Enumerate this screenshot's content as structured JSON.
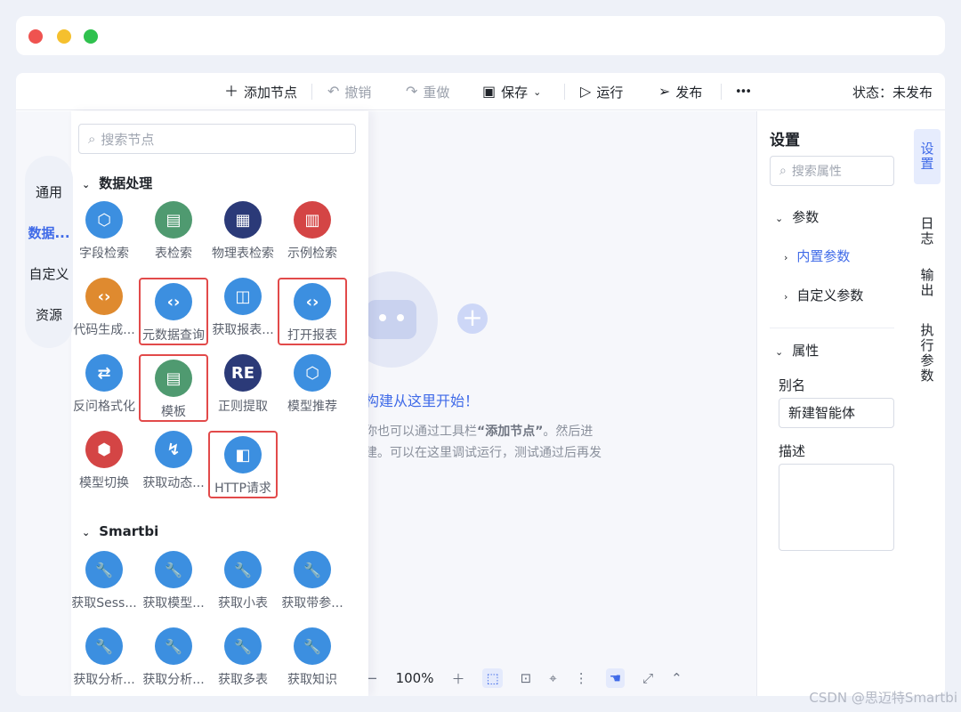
{
  "toolbar": {
    "add_node": "添加节点",
    "undo": "撤销",
    "redo": "重做",
    "save": "保存",
    "run": "运行",
    "publish": "发布",
    "more": "•••",
    "status": "状态：未发布"
  },
  "left_rail": [
    "通用",
    "数据...",
    "自定义",
    "资源"
  ],
  "panel": {
    "search_placeholder": "搜索节点",
    "sections": [
      {
        "title": "数据处理",
        "nodes": [
          {
            "label": "字段检索",
            "color": "#3c8fe0",
            "icon": "cube-search-icon",
            "highlighted": false
          },
          {
            "label": "表检索",
            "color": "#4f9a70",
            "icon": "table-search-icon",
            "highlighted": false
          },
          {
            "label": "物理表检索",
            "color": "#2b3a78",
            "icon": "physical-table-search-icon",
            "highlighted": false
          },
          {
            "label": "示例检索",
            "color": "#d44545",
            "icon": "example-search-icon",
            "highlighted": false
          },
          {
            "label": "代码生成...",
            "color": "#df8a2f",
            "icon": "code-gen-icon",
            "highlighted": false
          },
          {
            "label": "元数据查询",
            "color": "#3c8fe0",
            "icon": "code-window-icon",
            "highlighted": true
          },
          {
            "label": "获取报表...",
            "color": "#3c8fe0",
            "icon": "report-search-icon",
            "highlighted": false
          },
          {
            "label": "打开报表",
            "color": "#3c8fe0",
            "icon": "code-window-icon",
            "highlighted": true
          },
          {
            "label": "反问格式化",
            "color": "#3c8fe0",
            "icon": "format-icon",
            "highlighted": false
          },
          {
            "label": "模板",
            "color": "#4f9a70",
            "icon": "template-icon",
            "highlighted": true
          },
          {
            "label": "正则提取",
            "color": "#2b3a78",
            "icon": "regex-icon",
            "highlighted": false
          },
          {
            "label": "模型推荐",
            "color": "#3c8fe0",
            "icon": "cube-star-icon",
            "highlighted": false
          },
          {
            "label": "模型切换",
            "color": "#d44545",
            "icon": "cube-switch-icon",
            "highlighted": false
          },
          {
            "label": "获取动态...",
            "color": "#3c8fe0",
            "icon": "dynamic-icon",
            "highlighted": false
          },
          {
            "label": "HTTP请求",
            "color": "#3c8fe0",
            "icon": "layout-icon",
            "highlighted": true
          }
        ]
      },
      {
        "title": "Smartbi",
        "nodes": [
          {
            "label": "获取Sess...",
            "color": "#3c8fe0",
            "icon": "wrench-icon",
            "highlighted": false
          },
          {
            "label": "获取模型...",
            "color": "#3c8fe0",
            "icon": "wrench-icon",
            "highlighted": false
          },
          {
            "label": "获取小表",
            "color": "#3c8fe0",
            "icon": "wrench-icon",
            "highlighted": false
          },
          {
            "label": "获取带参...",
            "color": "#3c8fe0",
            "icon": "wrench-icon",
            "highlighted": false
          },
          {
            "label": "获取分析...",
            "color": "#3c8fe0",
            "icon": "wrench-icon",
            "highlighted": false
          },
          {
            "label": "获取分析...",
            "color": "#3c8fe0",
            "icon": "wrench-icon",
            "highlighted": false
          },
          {
            "label": "获取多表",
            "color": "#3c8fe0",
            "icon": "wrench-icon",
            "highlighted": false
          },
          {
            "label": "获取知识",
            "color": "#3c8fe0",
            "icon": "wrench-icon",
            "highlighted": false
          }
        ]
      }
    ]
  },
  "canvas": {
    "title": "构建从这里开始！",
    "desc_line1_prefix": "你也可以通过工具栏",
    "desc_bold": "“添加节点”",
    "desc_line1_suffix": "。然后进",
    "desc_line2": "建。可以在这里调试运行，测试通过后再发",
    "zoom": "100%"
  },
  "settings": {
    "title": "设置",
    "search_placeholder": "搜索属性",
    "params_label": "参数",
    "builtin_params": "内置参数",
    "custom_params": "自定义参数",
    "props_label": "属性",
    "alias_label": "别名",
    "alias_value": "新建智能体",
    "desc_label": "描述",
    "desc_value": ""
  },
  "vtabs": [
    "设\n置",
    "日\n志",
    "输\n出",
    "执\n行\n参\n数"
  ],
  "watermark": "CSDN @思迈特Smartbi"
}
